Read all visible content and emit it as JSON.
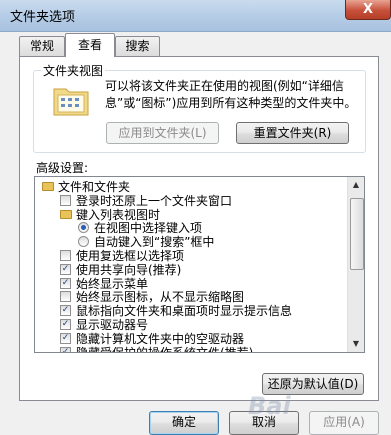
{
  "window": {
    "title": "文件夹选项",
    "close_glyph": "X"
  },
  "tabs": [
    {
      "label": "常规",
      "active": false
    },
    {
      "label": "查看",
      "active": true
    },
    {
      "label": "搜索",
      "active": false
    }
  ],
  "folder_views": {
    "legend": "文件夹视图",
    "description": "可以将该文件夹正在使用的视图(例如“详细信息”或“图标”)应用到所有这种类型的文件夹中。",
    "apply_button": "应用到文件夹(L)",
    "reset_button": "重置文件夹(R)"
  },
  "advanced": {
    "label": "高级设置:",
    "items": [
      {
        "type": "folder",
        "label": "文件和文件夹",
        "indent": 0
      },
      {
        "type": "checkbox",
        "label": "登录时还原上一个文件夹窗口",
        "checked": false,
        "indent": 1
      },
      {
        "type": "folder",
        "label": "键入列表视图时",
        "indent": 1
      },
      {
        "type": "radio",
        "label": "在视图中选择键入项",
        "checked": true,
        "indent": 2
      },
      {
        "type": "radio",
        "label": "自动键入到“搜索”框中",
        "checked": false,
        "indent": 2
      },
      {
        "type": "checkbox",
        "label": "使用复选框以选择项",
        "checked": false,
        "indent": 1
      },
      {
        "type": "checkbox",
        "label": "使用共享向导(推荐)",
        "checked": true,
        "indent": 1
      },
      {
        "type": "checkbox",
        "label": "始终显示菜单",
        "checked": true,
        "indent": 1
      },
      {
        "type": "checkbox",
        "label": "始终显示图标，从不显示缩略图",
        "checked": false,
        "indent": 1
      },
      {
        "type": "checkbox",
        "label": "鼠标指向文件夹和桌面项时显示提示信息",
        "checked": true,
        "indent": 1
      },
      {
        "type": "checkbox",
        "label": "显示驱动器号",
        "checked": true,
        "indent": 1
      },
      {
        "type": "checkbox",
        "label": "隐藏计算机文件夹中的空驱动器",
        "checked": true,
        "indent": 1
      },
      {
        "type": "checkbox",
        "label": "隐藏受保护的操作系统文件(推荐)",
        "checked": true,
        "indent": 1
      }
    ],
    "restore_defaults_button": "还原为默认值(D)"
  },
  "footer": {
    "ok_button": "确定",
    "cancel_button": "取消",
    "apply_button": "应用(A)"
  },
  "watermark": "Bai"
}
